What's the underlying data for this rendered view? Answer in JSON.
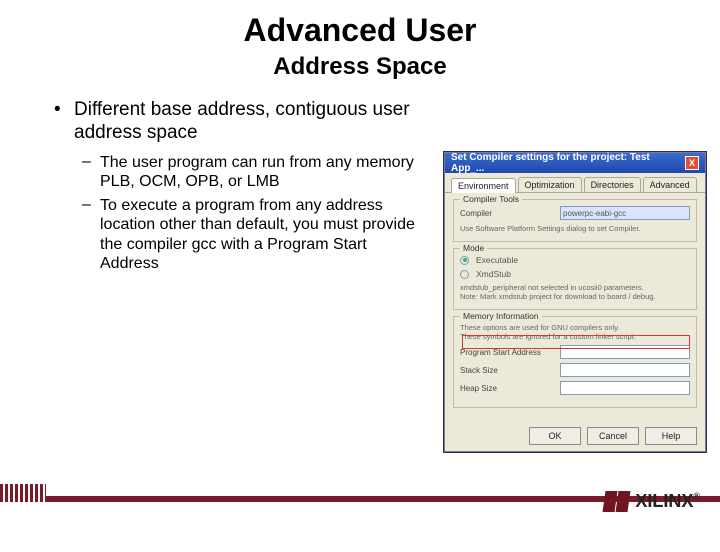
{
  "title": "Advanced User",
  "subtitle": "Address Space",
  "bullet": "Different base address, contiguous user address space",
  "subbullets": [
    "The user program can run from any memory PLB, OCM, OPB, or LMB",
    "To execute a program from any address location other than default, you must provide the compiler gcc with a Program Start Address"
  ],
  "dialog": {
    "title": "Set Compiler settings for the project: Test App_...",
    "close": "X",
    "tabs": [
      "Environment",
      "Optimization",
      "Directories",
      "Advanced"
    ],
    "group_compiler": "Compiler Tools",
    "compiler_label": "Compiler",
    "compiler_value": "powerpc-eabi-gcc",
    "compiler_note": "Use Software Platform Settings dialog to set Compiler.",
    "group_mode": "Mode",
    "mode_exec": "Executable",
    "mode_xmd": "XmdStub",
    "mode_note1": "xmdstub_peripheral not selected in ucosii0 parameters.",
    "mode_note2": "Note: Mark xmdstub project for download to board / debug.",
    "group_mem": "Memory Information",
    "mem_note1": "These options are used for GNU compilers only.",
    "mem_note2": "These symbols are ignored for a custom linker script.",
    "psa_label": "Program Start Address",
    "stack_label": "Stack Size",
    "heap_label": "Heap Size",
    "ok": "OK",
    "cancel": "Cancel",
    "help": "Help"
  },
  "logo_text": "XILINX",
  "logo_reg": "®"
}
